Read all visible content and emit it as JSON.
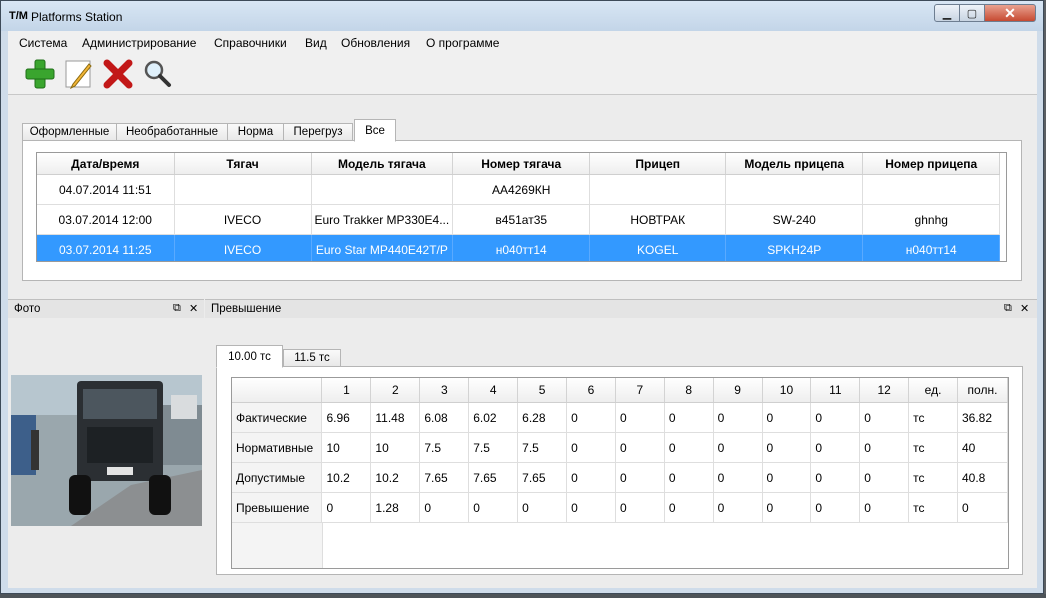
{
  "window": {
    "logo": "T/M",
    "title": "Platforms Station"
  },
  "menu": [
    "Система",
    "Администрирование",
    "Справочники",
    "Вид",
    "Обновления",
    "О программе"
  ],
  "toolbar": {
    "icons": [
      "add-icon",
      "edit-icon",
      "delete-icon",
      "search-icon"
    ]
  },
  "main_tabs": {
    "items": [
      "Оформленные",
      "Необработанные",
      "Норма",
      "Перегруз",
      "Все"
    ],
    "active": "Все"
  },
  "records": {
    "columns": [
      "Дата/время",
      "Тягач",
      "Модель тягача",
      "Номер тягача",
      "Прицеп",
      "Модель прицепа",
      "Номер прицепа"
    ],
    "rows": [
      [
        "04.07.2014 11:51",
        "",
        "",
        "АА4269КН",
        "",
        "",
        ""
      ],
      [
        "03.07.2014 12:00",
        "IVECO",
        "Euro Trakker MP330E4...",
        "в451ат35",
        "НОВТРАК",
        "SW-240",
        "ghnhg"
      ],
      [
        "03.07.2014 11:25",
        "IVECO",
        "Euro Star MP440E42T/P",
        "н040тт14",
        "KOGEL",
        "SPKH24P",
        "н040тт14"
      ]
    ],
    "selected_row": 2
  },
  "docks": {
    "photo_title": "Фото",
    "exceedance_title": "Превышение"
  },
  "exceedance_tabs": {
    "items": [
      "10.00 тс",
      "11.5 тс"
    ],
    "active": "10.00 тс"
  },
  "measures": {
    "columns": [
      "",
      "1",
      "2",
      "3",
      "4",
      "5",
      "6",
      "7",
      "8",
      "9",
      "10",
      "11",
      "12",
      "ед.",
      "полн."
    ],
    "rows": [
      [
        "Фактические",
        "6.96",
        "11.48",
        "6.08",
        "6.02",
        "6.28",
        "0",
        "0",
        "0",
        "0",
        "0",
        "0",
        "0",
        "тс",
        "36.82"
      ],
      [
        "Нормативные",
        "10",
        "10",
        "7.5",
        "7.5",
        "7.5",
        "0",
        "0",
        "0",
        "0",
        "0",
        "0",
        "0",
        "тс",
        "40"
      ],
      [
        "Допустимые",
        "10.2",
        "10.2",
        "7.65",
        "7.65",
        "7.65",
        "0",
        "0",
        "0",
        "0",
        "0",
        "0",
        "0",
        "тс",
        "40.8"
      ],
      [
        "Превышение",
        "0",
        "1.28",
        "0",
        "0",
        "0",
        "0",
        "0",
        "0",
        "0",
        "0",
        "0",
        "0",
        "тс",
        "0"
      ]
    ]
  },
  "colors": {
    "selection": "#3399ff",
    "title_bar": "#cfdcea",
    "close_button": "#c64a32"
  }
}
